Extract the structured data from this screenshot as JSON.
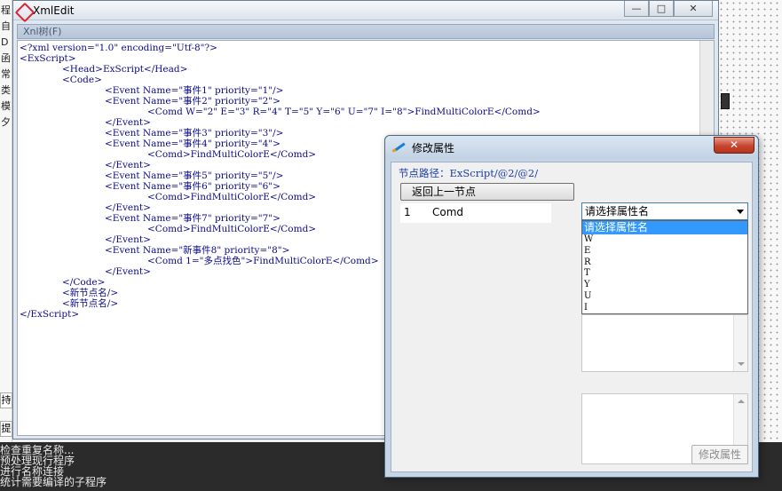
{
  "background": {
    "left_chars": [
      "程",
      "自",
      "D",
      "函",
      "常",
      "类",
      "模",
      "夕"
    ],
    "side_label_1": "持",
    "side_label_2": "提",
    "console_lines": [
      "检查重复名称...",
      "预处理现行程序",
      "进行名称连接",
      "统计需要编译的子程序"
    ]
  },
  "xml_window": {
    "title": "XmlEdit",
    "menu": "Xnl树(F)",
    "controls": {
      "minimize": "—",
      "maximize": "□",
      "close": "✕"
    },
    "lines": [
      "<?xml version=\"1.0\" encoding=\"Utf-8\"?>",
      "<ExScript>",
      "<Head>ExScript</Head>",
      "<Code>",
      "<Event Name=\"事件1\" priority=\"1\"/>",
      "<Event Name=\"事件2\" priority=\"2\">",
      "<Comd W=\"2\" E=\"3\" R=\"4\" T=\"5\" Y=\"6\" U=\"7\" I=\"8\">FindMultiColorE</Comd>",
      "</Event>",
      "<Event Name=\"事件3\" priority=\"3\"/>",
      "<Event Name=\"事件4\" priority=\"4\">",
      "<Comd>FindMultiColorE</Comd>",
      "</Event>",
      "<Event Name=\"事件5\" priority=\"5\"/>",
      "<Event Name=\"事件6\" priority=\"6\">",
      "<Comd>FindMultiColorE</Comd>",
      "</Event>",
      "<Event Name=\"事件7\" priority=\"7\">",
      "<Comd>FindMultiColorE</Comd>",
      "</Event>",
      "<Event Name=\"新事件8\" priority=\"8\">",
      "<Comd 1=\"多点找色\">FindMultiColorE</Comd>",
      "</Event>",
      "</Code>",
      "<新节点名/>",
      "<新节点名/>",
      "</ExScript>"
    ]
  },
  "dialog": {
    "title": "修改属性",
    "close": "✕",
    "path_label": "节点路径：ExScript/@2/@2/",
    "back_button": "返回上一节点",
    "nodes": [
      {
        "index": "1",
        "name": "Comd"
      }
    ],
    "combo_value": "请选择属性名",
    "dropdown_options": [
      "请选择属性名",
      "W",
      "E",
      "R",
      "T",
      "Y",
      "U",
      "I"
    ],
    "modify_button": "修改属性"
  }
}
